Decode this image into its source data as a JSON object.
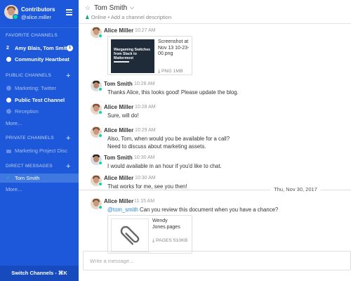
{
  "sidebar": {
    "team_name": "Contributors",
    "username": "@alice.miller",
    "favorite_channels_header": "FAVORITE CHANNELS",
    "favorites": [
      {
        "label": "Amy Blais, Tom Smith",
        "badge": "1",
        "icon_label": "2"
      },
      {
        "label": "Community Heartbeat"
      }
    ],
    "public_channels_header": "PUBLIC CHANNELS",
    "public_channels": [
      {
        "label": "Marketing: Twitter"
      },
      {
        "label": "Public Test Channel"
      },
      {
        "label": "Reception"
      }
    ],
    "public_more": "More...",
    "private_channels_header": "PRIVATE CHANNELS",
    "private_channels": [
      {
        "label": "Marketing Project Disc"
      }
    ],
    "direct_messages_header": "DIRECT MESSAGES",
    "direct_messages": [
      {
        "label": "Tom Smith"
      }
    ],
    "dm_more": "More...",
    "switch_channels": "Switch Channels - ⌘K",
    "accent_color": "#1c58d9",
    "active_item_color": "#3f78e0"
  },
  "header": {
    "channel_name": "Tom Smith",
    "status": "Online",
    "description_link": "Add a channel description",
    "separator": "•"
  },
  "posts": [
    {
      "user": "Alice Miller",
      "time": "10:27 AM",
      "file": {
        "thumb_title": "Wargaming Switches from Slack to Mattermost",
        "name": "Screenshot at Nov 13 10-23-00.png",
        "meta": "PNG 1MB"
      }
    },
    {
      "user": "Tom Smith",
      "time": "10:28 AM",
      "text": "Thanks Alice, this looks good! Please update the blog."
    },
    {
      "user": "Alice Miller",
      "time": "10:28 AM",
      "text": "Sure, will do!"
    },
    {
      "user": "Alice Miller",
      "time": "10:29 AM",
      "lines": [
        "Also, Tom, when would you be available for a call?",
        "Need to discuss about marketing assets."
      ]
    },
    {
      "user": "Tom Smith",
      "time": "10:30 AM",
      "text": "I would available in an hour if you'd like to chat."
    },
    {
      "user": "Alice Miller",
      "time": "10:30 AM",
      "text": "That works for me, see you then!"
    },
    {
      "user": "Alice Miller",
      "time": "11:15 AM",
      "mention": "@tom_smith",
      "text": " Can you review this document when you have a chance?",
      "file": {
        "name": "Wendy Jones.pages",
        "meta": "PAGES 510KB"
      }
    }
  ],
  "date_separator": "Thu, Nov 30, 2017",
  "input": {
    "placeholder": "Write a message..."
  },
  "colors": {
    "online": "#06d6a0",
    "mention": "#2389d7"
  }
}
